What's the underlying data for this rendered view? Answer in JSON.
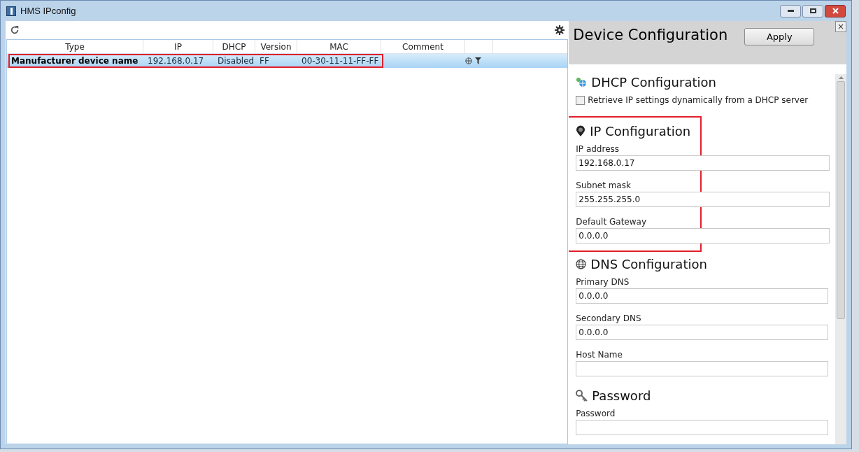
{
  "window": {
    "title": "HMS IPconfig"
  },
  "table": {
    "columns": [
      "Type",
      "IP",
      "DHCP",
      "Version",
      "MAC",
      "Comment"
    ],
    "rows": [
      {
        "cells": [
          "Manufacturer device name",
          "192.168.0.17",
          "Disabled",
          "FF",
          "00-30-11-11-FF-FF",
          ""
        ],
        "selected": true,
        "highlighted": true
      }
    ]
  },
  "panel": {
    "title": "Device Configuration",
    "apply": "Apply",
    "close": "×",
    "sections": [
      {
        "kind": "dhcp",
        "title": "DHCP Configuration",
        "highlighted": false,
        "checkbox": {
          "label": "Retrieve IP settings dynamically from a DHCP server",
          "checked": false
        }
      },
      {
        "kind": "ip",
        "title": "IP Configuration",
        "highlighted": true,
        "fields": [
          {
            "label": "IP address",
            "value": "192.168.0.17"
          },
          {
            "label": "Subnet mask",
            "value": "255.255.255.0"
          },
          {
            "label": "Default Gateway",
            "value": "0.0.0.0"
          }
        ]
      },
      {
        "kind": "dns",
        "title": "DNS Configuration",
        "highlighted": false,
        "fields": [
          {
            "label": "Primary DNS",
            "value": "0.0.0.0"
          },
          {
            "label": "Secondary DNS",
            "value": "0.0.0.0"
          },
          {
            "label": "Host Name"
          }
        ]
      },
      {
        "kind": "password",
        "title": "Password",
        "highlighted": false,
        "fields": [
          {
            "label": "Password"
          }
        ]
      }
    ]
  }
}
